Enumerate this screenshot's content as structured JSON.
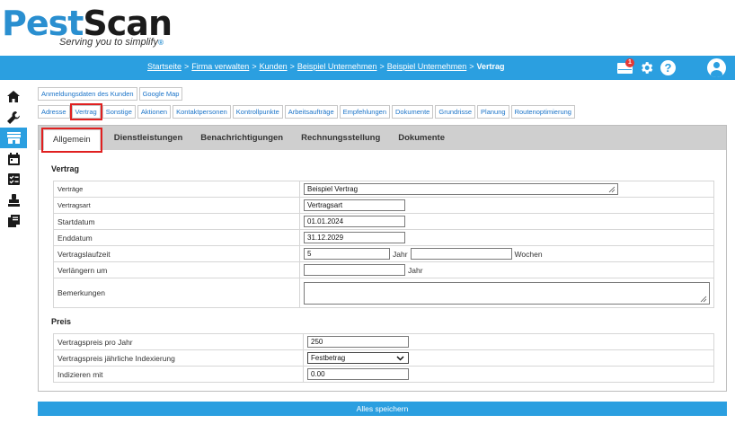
{
  "logo": {
    "part1": "Pest",
    "part2": "Scan",
    "tagline": "Serving you to simplify",
    "tag_mark": "®"
  },
  "breadcrumb": {
    "items": [
      "Startseite",
      "Firma verwalten",
      "Kunden",
      "Beispiel Unternehmen",
      "Beispiel Unternehmen"
    ],
    "separator": ">",
    "current": "Vertrag"
  },
  "header": {
    "notification_count": "1"
  },
  "colors": {
    "accent": "#2b9fe0",
    "highlight": "#e02020",
    "tabbar": "#cfcfcf"
  },
  "sidebar": {
    "items": [
      "home-icon",
      "wrench-icon",
      "store-icon",
      "calendar-icon",
      "checklist-icon",
      "stamp-icon",
      "book-icon"
    ],
    "active_index": 2
  },
  "buttons_row1": [
    "Anmeldungsdaten des Kunden",
    "Google Map"
  ],
  "buttons_row2": [
    "Adresse",
    "Vertrag",
    "Sonstige",
    "Aktionen",
    "Kontaktpersonen",
    "Kontrollpunkte",
    "Arbeitsaufträge",
    "Empfehlungen",
    "Dokumente",
    "Grundrisse",
    "Planung",
    "Routenoptimierung"
  ],
  "tabs": [
    "Allgemein",
    "Dienstleistungen",
    "Benachrichtigungen",
    "Rechnungsstellung",
    "Dokumente"
  ],
  "vertrag": {
    "title": "Vertrag",
    "vertraege_label": "Verträge",
    "vertraege_value": "Beispiel Vertrag",
    "art_label": "Vertragsart",
    "art_value": "Vertragsart",
    "start_label": "Startdatum",
    "start_value": "01.01.2024",
    "end_label": "Enddatum",
    "end_value": "31.12.2029",
    "laufzeit_label": "Vertragslaufzeit",
    "laufzeit_value": "5",
    "jahr_unit": "Jahr",
    "wochen_value": "",
    "wochen_unit": "Wochen",
    "verlaengern_label": "Verlängern um",
    "verlaengern_value": "",
    "verlaengern_unit": "Jahr",
    "bemerkungen_label": "Bemerkungen",
    "bemerkungen_value": ""
  },
  "preis": {
    "title": "Preis",
    "jahr_label": "Vertragspreis pro Jahr",
    "jahr_value": "250",
    "index_label": "Vertragspreis jährliche Indexierung",
    "index_value": "Festbetrag",
    "indiz_label": "Indizieren mit",
    "indiz_value": "0.00"
  },
  "save_label": "Alles speichern"
}
